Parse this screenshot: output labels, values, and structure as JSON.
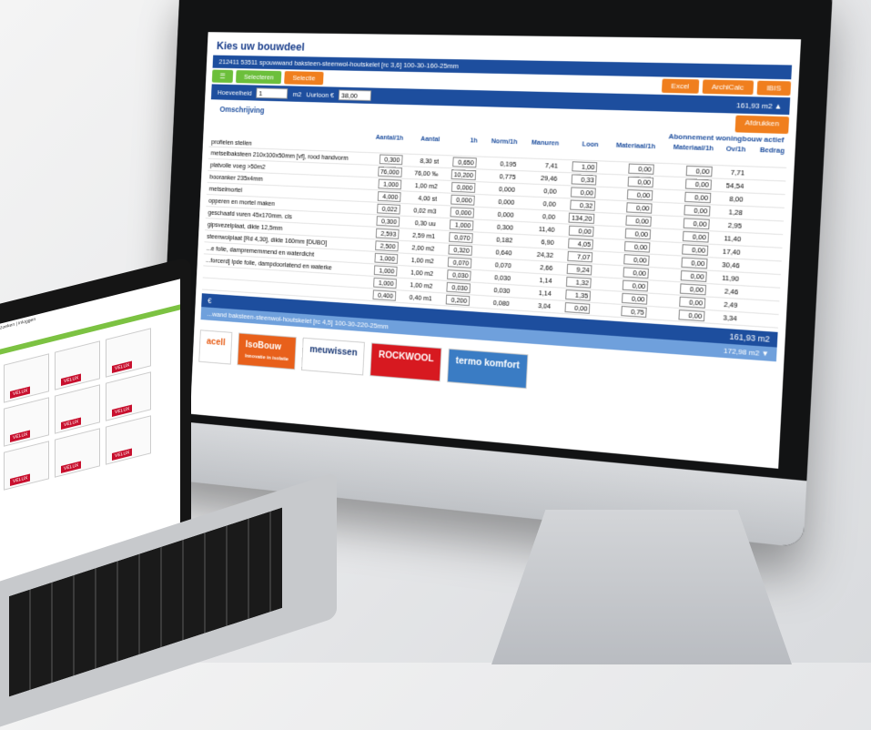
{
  "app": {
    "title": "Kies uw bouwdeel",
    "project_line": "212411 53511 spouwwand baksteen-steenwol-houtskelet [rc 3,6] 100-30-160-25mm",
    "buttons": {
      "selecteren": "Selecteren",
      "selectie": "Selectie",
      "excel": "Excel",
      "archicalc": "ArchiCalc",
      "ibis": "IBIS"
    },
    "qty_label": "Hoeveelheid",
    "qty_unit": "m2",
    "uurloon_label": "Uurloon €",
    "uurloon_value": "38,00",
    "price_total": "161,93 m2 ▲",
    "afdrukken": "Afdrukken",
    "abonnement": "Abonnement woningbouw actief",
    "omschrijving": "Omschrijving"
  },
  "columns": [
    "Aantal/1h",
    "Aantal",
    "1h",
    "Norm/1h",
    "Manuren",
    "Loon",
    "Materiaal/1h",
    "Materiaal/1h",
    "Ov/1h",
    "Bedrag"
  ],
  "rows": [
    {
      "desc": "profielen stellen",
      "vals": []
    },
    {
      "desc": "metselbaksteen 210x100x50mm [vf], rood handvorm",
      "vals": [
        "0,300",
        "8,30 st",
        "0,650",
        "0,195",
        "7,41",
        "1,00",
        "0,00",
        "0,00",
        "7,71"
      ]
    },
    {
      "desc": "platvolle voeg >50m2",
      "vals": [
        "76,000",
        "76,00 ‰",
        "10,200",
        "0,775",
        "29,46",
        "0,33",
        "0,00",
        "0,00",
        "54,54"
      ]
    },
    {
      "desc": "booranker 235x4mm",
      "vals": [
        "1,000",
        "1,00 m2",
        "0,000",
        "0,000",
        "0,00",
        "0,00",
        "0,00",
        "0,00",
        "8,00"
      ]
    },
    {
      "desc": "metselmortel",
      "vals": [
        "4,000",
        "4,00 st",
        "0,000",
        "0,000",
        "0,00",
        "0,32",
        "0,00",
        "0,00",
        "1,28"
      ]
    },
    {
      "desc": "opperen en mortel maken",
      "vals": [
        "0,022",
        "0,02 m3",
        "0,000",
        "0,000",
        "0,00",
        "134,20",
        "0,00",
        "0,00",
        "2,95"
      ]
    },
    {
      "desc": "geschaafd vuren 45x170mm. cls",
      "vals": [
        "0,300",
        "0,30 uu",
        "1,000",
        "0,300",
        "11,40",
        "0,00",
        "0,00",
        "0,00",
        "11,40"
      ]
    },
    {
      "desc": "gipsvezelplaat, dikte 12,5mm",
      "vals": [
        "2,593",
        "2,59 m1",
        "0,070",
        "0,182",
        "6,90",
        "4,05",
        "0,00",
        "0,00",
        "17,40"
      ]
    },
    {
      "desc": "steenwolplaat [Rd 4,30], dikte 160mm [DUBO]",
      "vals": [
        "2,500",
        "2,00 m2",
        "0,320",
        "0,640",
        "24,32",
        "7,07",
        "0,00",
        "0,00",
        "30,46"
      ]
    },
    {
      "desc": "...e folie, damprememmend en waterdicht",
      "vals": [
        "1,000",
        "1,00 m2",
        "0,070",
        "0,070",
        "2,66",
        "9,24",
        "0,00",
        "0,00",
        "11,90"
      ]
    },
    {
      "desc": "...forcerd] lpde folie, dampdoorlatend en waterke",
      "vals": [
        "1,000",
        "1,00 m2",
        "0,030",
        "0,030",
        "1,14",
        "1,32",
        "0,00",
        "0,00",
        "2,46"
      ]
    },
    {
      "desc": "",
      "vals": [
        "1,000",
        "1,00 m2",
        "0,030",
        "0,030",
        "1,14",
        "1,35",
        "0,00",
        "0,00",
        "2,49"
      ]
    },
    {
      "desc": "",
      "vals": [
        "0,400",
        "0,40 m1",
        "0,200",
        "0,080",
        "3,04",
        "0,00",
        "0,75",
        "0,00",
        "3,34"
      ]
    }
  ],
  "totals": {
    "line1_label": "€",
    "line1_value": "161,93 m2",
    "line2_value": "172,98 m2 ▼",
    "sub": "...wand baksteen-steenwol-houtskelet [rc 4,5] 100-30-220-25mm"
  },
  "logos": [
    "acell",
    "IsoBouw",
    "meuwissen",
    "ROCKWOOL",
    "termo komfort"
  ],
  "isobouw_tag": "Innovatie in isolatie",
  "laptop": {
    "menu": "zoeken | inloggen",
    "tag": "VELUX"
  }
}
